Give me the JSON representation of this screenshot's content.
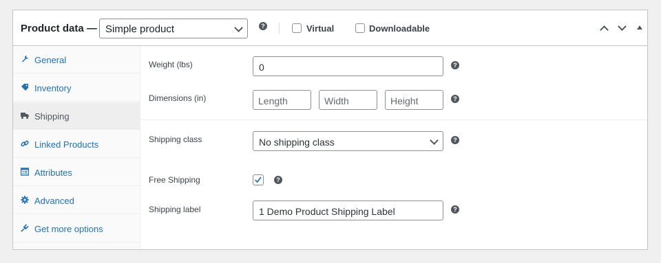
{
  "header": {
    "title": "Product data —",
    "product_type": "Simple product",
    "virtual_label": "Virtual",
    "downloadable_label": "Downloadable"
  },
  "tabs": [
    {
      "label": "General",
      "icon": "wrench-icon"
    },
    {
      "label": "Inventory",
      "icon": "tag-icon"
    },
    {
      "label": "Shipping",
      "icon": "truck-icon",
      "active": true
    },
    {
      "label": "Linked Products",
      "icon": "link-icon"
    },
    {
      "label": "Attributes",
      "icon": "table-icon"
    },
    {
      "label": "Advanced",
      "icon": "gear-icon"
    },
    {
      "label": "Get more options",
      "icon": "plugin-icon"
    }
  ],
  "shipping": {
    "weight_label": "Weight (lbs)",
    "weight_value": "0",
    "dimensions_label": "Dimensions (in)",
    "length_placeholder": "Length",
    "width_placeholder": "Width",
    "height_placeholder": "Height",
    "class_label": "Shipping class",
    "class_value": "No shipping class",
    "free_shipping_label": "Free Shipping",
    "free_shipping_checked": true,
    "shipping_label_label": "Shipping label",
    "shipping_label_value": "1 Demo Product Shipping Label"
  },
  "colors": {
    "link": "#2271b1",
    "checkbox": "#2271b1"
  }
}
